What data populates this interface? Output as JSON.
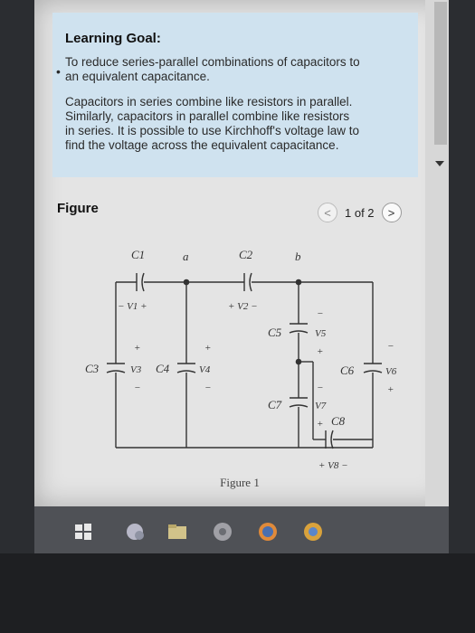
{
  "learning_goal": {
    "title": "Learning Goal:",
    "line1": "To reduce series-parallel combinations of capacitors to",
    "line2": "an equivalent capacitance.",
    "para2_line1": "Capacitors in series combine like resistors in parallel.",
    "para2_line2": "Similarly, capacitors in parallel combine like resistors",
    "para2_line3": "in series. It is possible to use Kirchhoff's voltage law to",
    "para2_line4": "find the voltage across the equivalent capacitance."
  },
  "figure": {
    "label": "Figure",
    "pager_text": "1 of 2",
    "prev_icon": "chevron-left",
    "next_icon": "chevron-right",
    "caption": "Figure 1"
  },
  "circuit": {
    "labels": {
      "c1": "C1",
      "c2": "C2",
      "c3": "C3",
      "c4": "C4",
      "c5": "C5",
      "c6": "C6",
      "c7": "C7",
      "c8": "C8",
      "a": "a",
      "b": "b",
      "v1": "− V1 +",
      "v2": "+ V2 −",
      "v3": "V3",
      "v4": "V4",
      "v5": "V5",
      "v6": "V6",
      "v7": "V7",
      "v8": "+ V8 −",
      "plus": "+",
      "minus": "−"
    }
  },
  "taskbar": {
    "icons": [
      "windows-start-icon",
      "app-icon",
      "file-explorer-icon",
      "media-player-icon",
      "firefox-icon",
      "chrome-icon"
    ]
  }
}
